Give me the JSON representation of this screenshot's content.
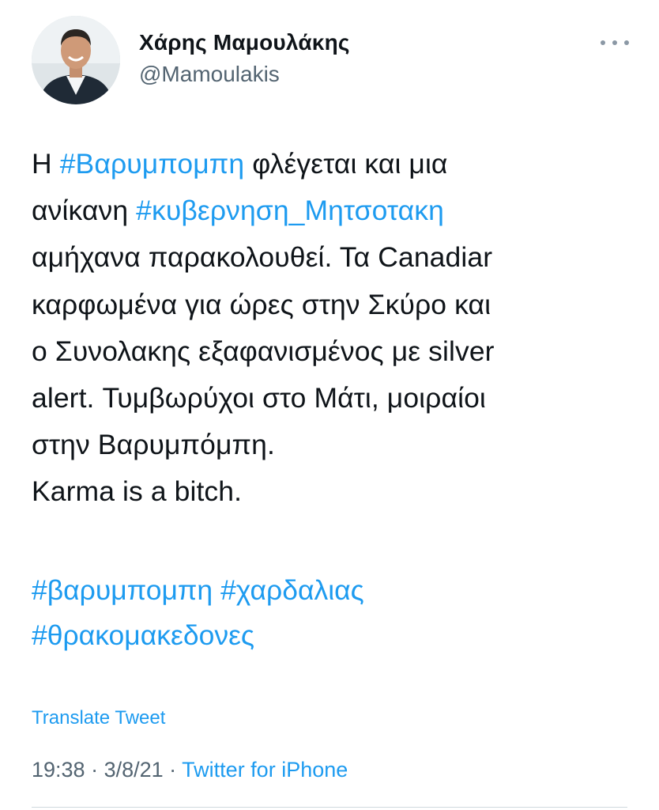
{
  "author": {
    "name": "Χάρης Μαμουλάκης",
    "handle": "@Mamoulakis",
    "avatar_icon": "profile-photo"
  },
  "menu_icon": "more-horizontal-icon",
  "tweet": {
    "lines": [
      [
        {
          "text": "Η "
        },
        {
          "text": "#Βαρυμπομπη",
          "hashtag": true
        },
        {
          "text": " φλέγεται και μια"
        }
      ],
      [
        {
          "text": "ανίκανη "
        },
        {
          "text": "#κυβερνηση_Μητσοτακη",
          "hashtag": true
        }
      ],
      [
        {
          "text": "αμήχανα παρακολουθεί. Τα Canadiar"
        }
      ],
      [
        {
          "text": "καρφωμένα για ώρες στην Σκύρο και"
        }
      ],
      [
        {
          "text": "ο Συνολακης εξαφανισμένος με silver"
        }
      ],
      [
        {
          "text": "alert. Τυμβωρύχοι στο Μάτι, μοιραίοι"
        }
      ],
      [
        {
          "text": "στην Βαρυμπόμπη."
        }
      ],
      [
        {
          "text": "Karma is a bitch."
        }
      ]
    ],
    "hashtags": [
      [
        "#βαρυμπομπη",
        "#χαρδαλιας"
      ],
      [
        "#θρακομακεδονες"
      ]
    ]
  },
  "translate_label": "Translate Tweet",
  "meta": {
    "time": "19:38",
    "separator": " · ",
    "date": "3/8/21",
    "source": "Twitter for iPhone"
  },
  "colors": {
    "link": "#1d9bf0",
    "secondary": "#536471",
    "text": "#0f1419"
  }
}
